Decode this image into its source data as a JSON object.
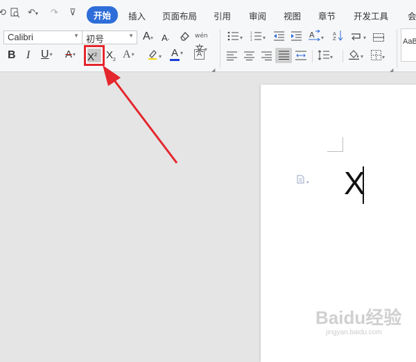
{
  "quick_access": {
    "icons": [
      "refresh-icon",
      "print-preview-icon",
      "undo-icon",
      "redo-icon",
      "customize-icon"
    ]
  },
  "tabs": [
    {
      "label": "开始",
      "active": true
    },
    {
      "label": "插入"
    },
    {
      "label": "页面布局"
    },
    {
      "label": "引用"
    },
    {
      "label": "审阅"
    },
    {
      "label": "视图"
    },
    {
      "label": "章节"
    },
    {
      "label": "开发工具"
    },
    {
      "label": "会"
    }
  ],
  "font": {
    "name": "Calibri",
    "size": "初号"
  },
  "toolbar": {
    "bold": "B",
    "italic": "I",
    "underline": "U",
    "strike": "A",
    "superscript": "X",
    "superscript_mark": "2",
    "subscript": "X",
    "subscript_mark": "2",
    "font_color": "A",
    "char_shade": "A",
    "grow_font": "A",
    "shrink_font": "A",
    "phonetic": "wén"
  },
  "styles": {
    "preview": "AaBl"
  },
  "document": {
    "text": "X"
  },
  "watermark": {
    "main": "Baidu经验",
    "sub": "jingyan.baidu.com"
  },
  "colors": {
    "accent": "#2e6ed9",
    "highlight": "#e4262d",
    "font_red": "#d9241f",
    "font_blue": "#1b3fd6"
  }
}
